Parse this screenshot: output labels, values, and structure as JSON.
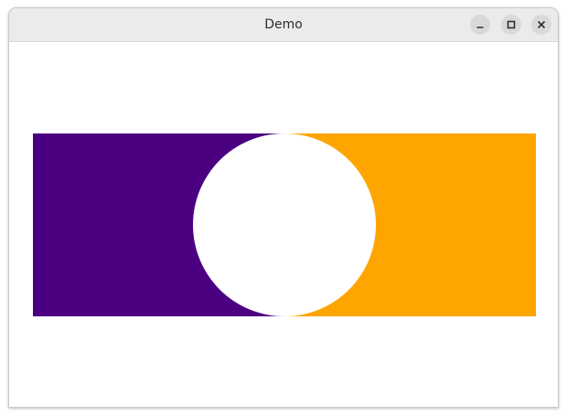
{
  "window": {
    "title": "Demo"
  },
  "icons": {
    "minimize": "minimize-icon",
    "maximize": "maximize-icon",
    "close": "close-icon"
  },
  "colors": {
    "titlebar": "#ebebeb",
    "left_rect": "#4b0082",
    "right_rect": "#ffa500",
    "circle": "#ffffff",
    "background": "#ffffff"
  }
}
